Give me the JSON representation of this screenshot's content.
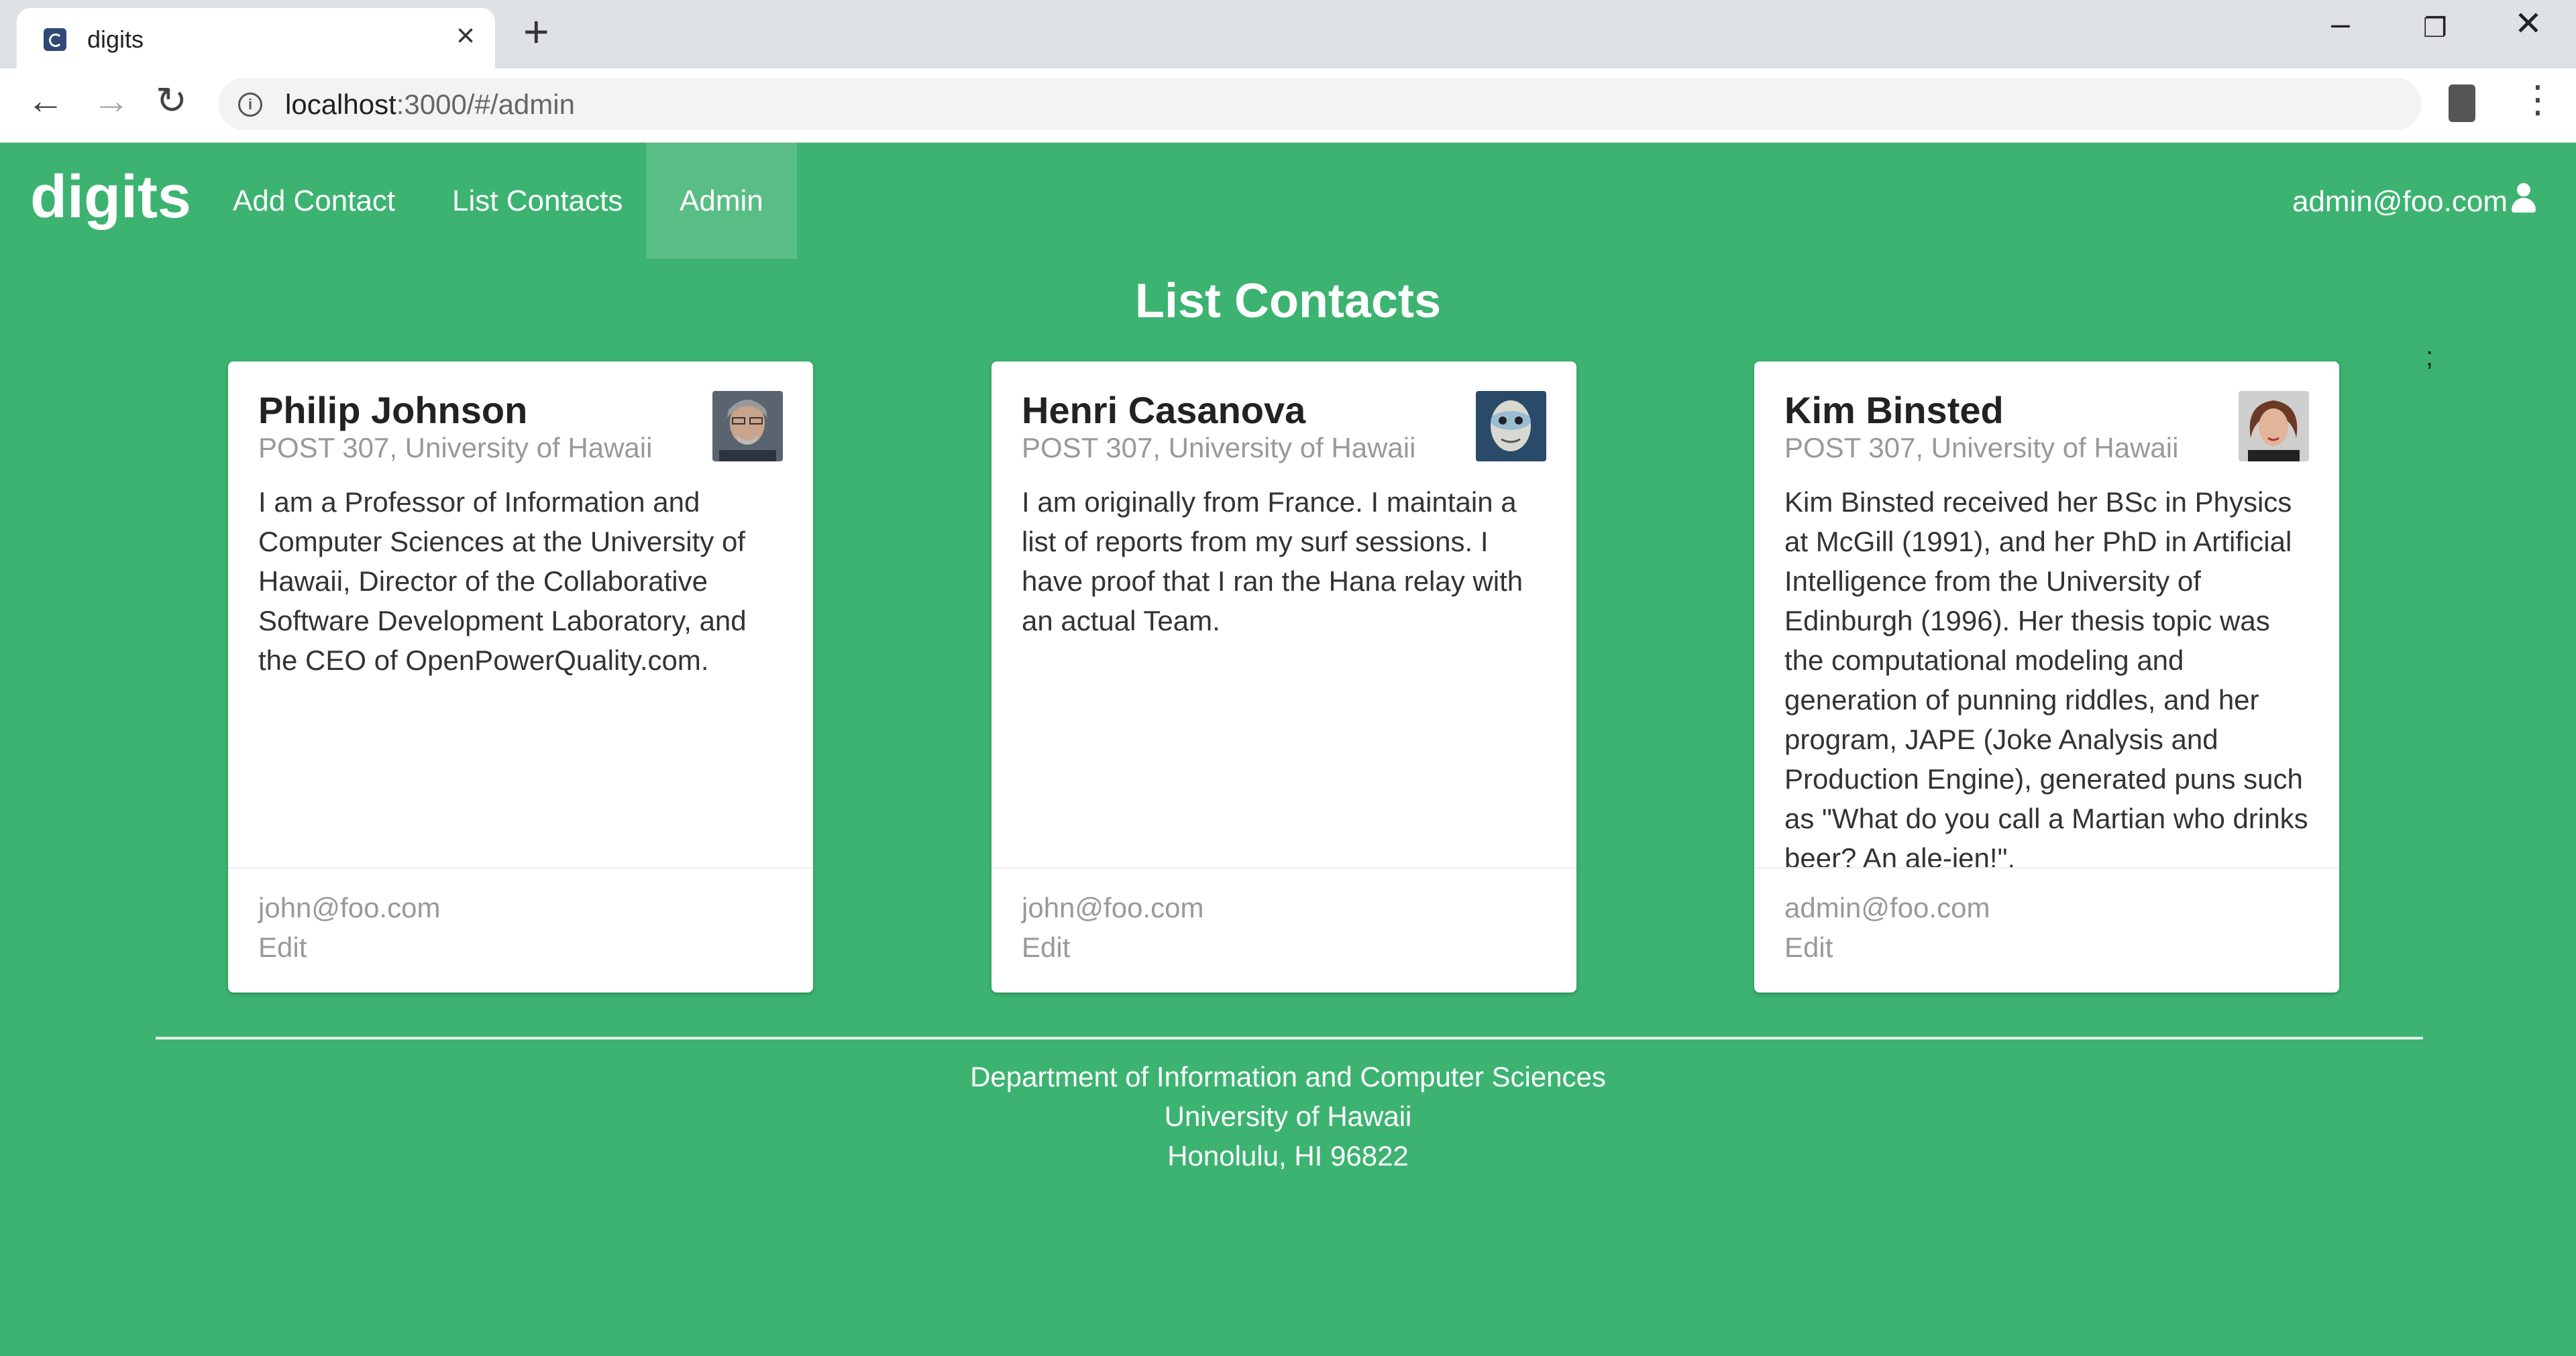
{
  "browser": {
    "tab_title": "digits",
    "url_host": "localhost",
    "url_rest": ":3000/#/admin"
  },
  "navbar": {
    "brand": "digits",
    "items": [
      "Add Contact",
      "List Contacts",
      "Admin"
    ],
    "active": "Admin",
    "user": "admin@foo.com"
  },
  "page": {
    "title": "List Contacts",
    "stray": ";"
  },
  "cards": [
    {
      "name": "Philip Johnson",
      "address": "POST 307, University of Hawaii",
      "description": "I am a Professor of Information and Computer Sciences at the University of Hawaii, Director of the Collaborative Software Development Laboratory, and the CEO of OpenPowerQuality.com.",
      "email": "john@foo.com",
      "edit_label": "Edit"
    },
    {
      "name": "Henri Casanova",
      "address": "POST 307, University of Hawaii",
      "description": "I am originally from France. I maintain a list of reports from my surf sessions. I have proof that I ran the Hana relay with an actual Team.",
      "email": "john@foo.com",
      "edit_label": "Edit"
    },
    {
      "name": "Kim Binsted",
      "address": "POST 307, University of Hawaii",
      "description": "Kim Binsted received her BSc in Physics at McGill (1991), and her PhD in Artificial Intelligence from the University of Edinburgh (1996). Her thesis topic was the computational modeling and generation of punning riddles, and her program, JAPE (Joke Analysis and Production Engine), generated puns such as \"What do you call a Martian who drinks beer? An ale-ien!\".",
      "email": "admin@foo.com",
      "edit_label": "Edit"
    }
  ],
  "footer": {
    "lines": [
      "Department of Information and Computer Sciences",
      "University of Hawaii",
      "Honolulu, HI 96822"
    ]
  },
  "colors": {
    "background": "#3cb371",
    "card": "#ffffff",
    "muted_text": "#999999"
  }
}
